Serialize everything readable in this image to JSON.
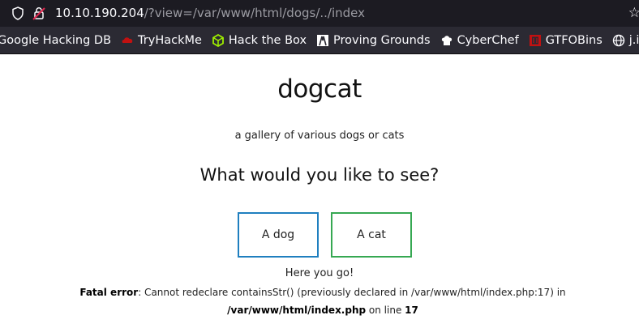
{
  "browser": {
    "url_host": "10.10.190.204",
    "url_path": "/?view=/var/www/html/dogs/../index"
  },
  "bookmarks": [
    {
      "label": "Google Hacking DB",
      "icon": "none"
    },
    {
      "label": "TryHackMe",
      "icon": "tryhackme-icon",
      "color": "#c11111"
    },
    {
      "label": "Hack the Box",
      "icon": "hackthebox-icon",
      "color": "#9fef00"
    },
    {
      "label": "Proving Grounds",
      "icon": "proving-grounds-icon",
      "color": "#ffffff"
    },
    {
      "label": "CyberChef",
      "icon": "cyberchef-icon",
      "color": "#ffffff"
    },
    {
      "label": "GTFOBins",
      "icon": "gtfobins-icon",
      "color": "#c11111"
    },
    {
      "label": "j.info Blog",
      "icon": "globe-icon",
      "color": "#ffffff"
    }
  ],
  "page": {
    "title": "dogcat",
    "subtitle": "a gallery of various dogs or cats",
    "question": "What would you like to see?",
    "dog_button": "A dog",
    "cat_button": "A cat",
    "result_text": "Here you go!",
    "error_label": "Fatal error",
    "error_message": ": Cannot redeclare containsStr() (previously declared in /var/www/html/index.php:17) in ",
    "error_file": "/var/www/html/index.php",
    "error_line_prefix": " on line ",
    "error_line": "17"
  }
}
